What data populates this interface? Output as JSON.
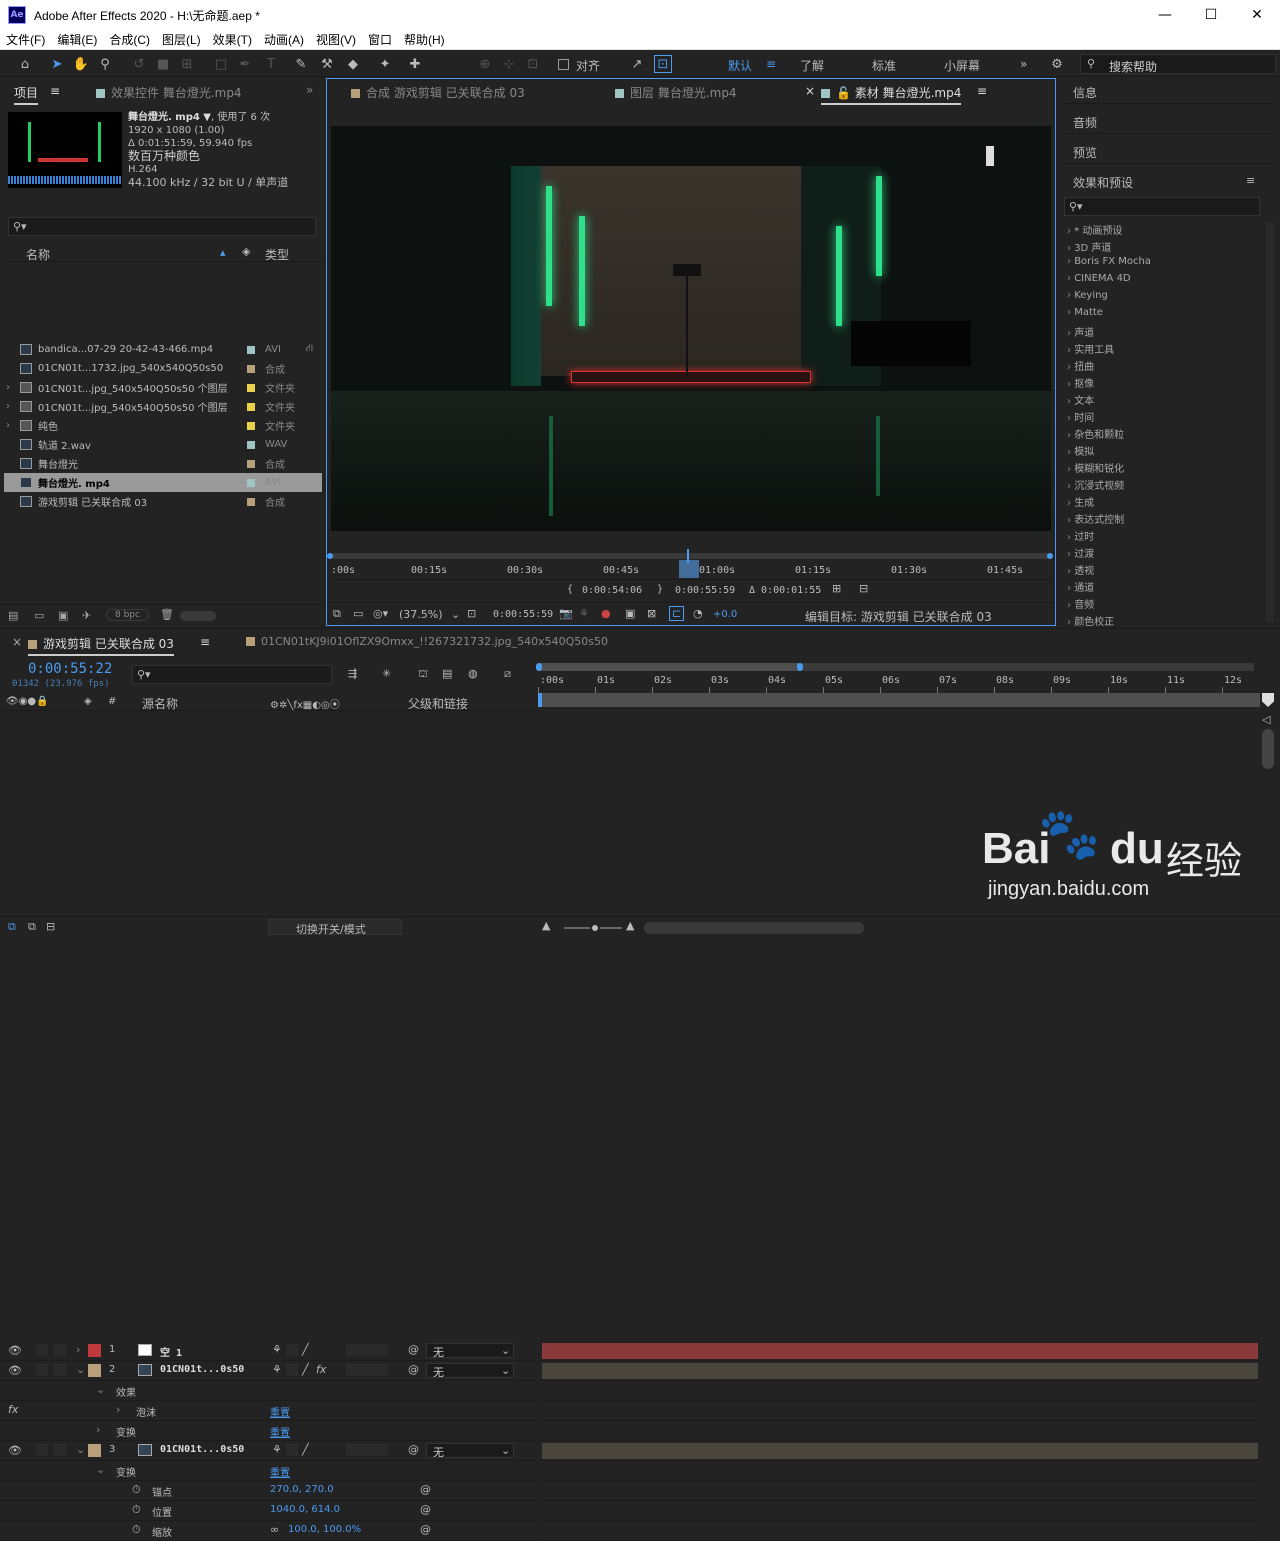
{
  "window": {
    "title": "Adobe After Effects 2020 - H:\\无命题.aep *",
    "logo": "Ae",
    "min": "—",
    "max": "☐",
    "close": "✕"
  },
  "menu": [
    "文件(F)",
    "编辑(E)",
    "合成(C)",
    "图层(L)",
    "效果(T)",
    "动画(A)",
    "视图(V)",
    "窗口",
    "帮助(H)"
  ],
  "toolbar": {
    "align_label": "对齐",
    "workspaces": [
      "默认",
      "了解",
      "标准",
      "小屏幕"
    ],
    "search_placeholder": "搜索帮助",
    "more": "»"
  },
  "project": {
    "tab": "项目",
    "tab2": "效果控件 舞台燈光.mp4",
    "info": {
      "name": "舞台燈光. mp4 ▼",
      "used": ", 使用了 6 次",
      "res": "1920 x 1080 (1.00)",
      "dur": "Δ 0:01:51:59, 59.940 fps",
      "colors": "数百万种颜色",
      "codec": "H.264",
      "audio": "44.100 kHz / 32 bit U / 单声道"
    },
    "cols": {
      "name": "名称",
      "type": "类型"
    },
    "items": [
      {
        "name": "bandica...07-29 20-42-43-466.mp4",
        "type": "AVI",
        "color": "#9ec4c4",
        "icon": "film-icon"
      },
      {
        "name": "01CN01t...1732.jpg_540x540Q50s50",
        "type": "合成",
        "color": "#b8a07a",
        "icon": "comp-icon"
      },
      {
        "name": "01CN01t...jpg_540x540Q50s50 个图层",
        "type": "文件夹",
        "color": "#e8d24a",
        "icon": "folder-icon"
      },
      {
        "name": "01CN01t...jpg_540x540Q50s50 个图层",
        "type": "文件夹",
        "color": "#e8d24a",
        "icon": "folder-icon"
      },
      {
        "name": "纯色",
        "type": "文件夹",
        "color": "#e8d24a",
        "icon": "folder-icon"
      },
      {
        "name": "轨道 2.wav",
        "type": "WAV",
        "color": "#9ec4c4",
        "icon": "audio-icon"
      },
      {
        "name": "舞台燈光",
        "type": "合成",
        "color": "#b8a07a",
        "icon": "comp-icon"
      },
      {
        "name": "舞台燈光. mp4",
        "type": "AVI",
        "color": "#9ec4c4",
        "icon": "film-icon"
      },
      {
        "name": "游戏剪辑 已关联合成 03",
        "type": "合成",
        "color": "#b8a07a",
        "icon": "comp-icon"
      }
    ],
    "bpc": "8 bpc"
  },
  "viewer": {
    "tabs": [
      "合成 游戏剪辑 已关联合成 03",
      "图层 舞台燈光.mp4",
      "素材 舞台燈光.mp4"
    ],
    "ruler": [
      ":00s",
      "00:15s",
      "00:30s",
      "00:45s",
      "01:00s",
      "01:15s",
      "01:30s",
      "01:45s"
    ],
    "in": "0:00:54:06",
    "out": "0:00:55:59",
    "dur": "Δ 0:00:01:55",
    "zoom": "(37.5%)",
    "time": "0:00:55:59",
    "offset": "+0.0",
    "target": "编辑目标: 游戏剪辑 已关联合成 03"
  },
  "right": {
    "panels": [
      "信息",
      "音频",
      "预览",
      "效果和预设"
    ],
    "fx": [
      "* 动画预设",
      "3D 声道",
      "Boris FX Mocha",
      "CINEMA 4D",
      "Keying",
      "Matte",
      "声道",
      "实用工具",
      "扭曲",
      "抠像",
      "文本",
      "时间",
      "杂色和颗粒",
      "模拟",
      "模糊和锐化",
      "沉浸式视频",
      "生成",
      "表达式控制",
      "过时",
      "过渡",
      "透视",
      "通道",
      "音频",
      "颜色校正"
    ]
  },
  "timeline": {
    "tabs": [
      "游戏剪辑 已关联合成 03",
      "01CN01tKJ9i01OflZX9Omxx_!!267321732.jpg_540x540Q50s50"
    ],
    "time": "0:00:55:22",
    "frames": "01342 (23.976 fps)",
    "head": {
      "src": "源名称",
      "parent": "父级和链接"
    },
    "ticks": [
      ":00s",
      "01s",
      "02s",
      "03s",
      "04s",
      "05s",
      "06s",
      "07s",
      "08s",
      "09s",
      "10s",
      "11s",
      "12s"
    ],
    "layers": [
      {
        "num": "1",
        "name": "空 1",
        "parent": "无",
        "label": "#c0393b",
        "bar": "#8a3a3a"
      },
      {
        "num": "2",
        "name": "01CN01t...0s50",
        "parent": "无",
        "label": "#b8a07a",
        "bar": "#4a453d"
      },
      {
        "num": "3",
        "name": "01CN01t...0s50",
        "parent": "无",
        "label": "#b8a07a",
        "bar": "#4a453d"
      }
    ],
    "sub": {
      "effects": "效果",
      "bubble": "泡沫",
      "transform": "变换",
      "reset": "重置",
      "anchor": "锚点",
      "anchor_v": "270.0, 270.0",
      "pos": "位置",
      "pos_v": "1040.0, 614.0",
      "scale": "缩放",
      "scale_v": "100.0, 100.0%"
    },
    "footer": "切换开关/模式"
  },
  "watermark": {
    "brand": "Bai",
    "brand2": "du",
    "cn": "经验",
    "url": "jingyan.baidu.com"
  }
}
